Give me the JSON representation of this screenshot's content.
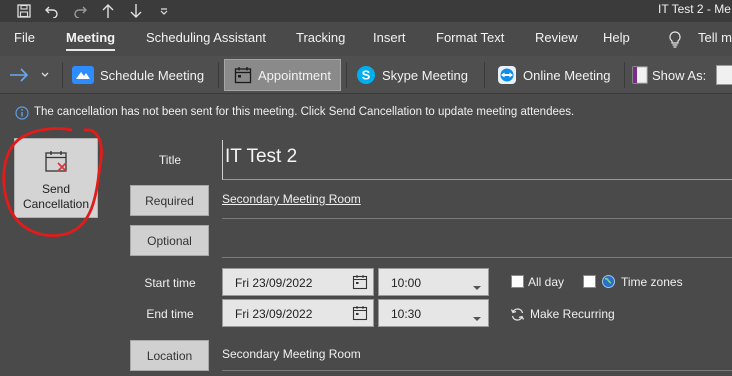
{
  "window": {
    "title": "IT Test 2  -  Me"
  },
  "quick_access": {
    "icons": [
      "save-icon",
      "undo-icon",
      "redo-icon",
      "up-arrow-icon",
      "down-arrow-icon",
      "customize-qat-icon"
    ]
  },
  "ribbon": {
    "tabs": [
      {
        "label": "File"
      },
      {
        "label": "Meeting",
        "active": true
      },
      {
        "label": "Scheduling Assistant"
      },
      {
        "label": "Tracking"
      },
      {
        "label": "Insert"
      },
      {
        "label": "Format Text"
      },
      {
        "label": "Review"
      },
      {
        "label": "Help"
      },
      {
        "label": "Tell m"
      }
    ],
    "toolbar": {
      "schedule_meeting": "Schedule Meeting",
      "appointment": "Appointment",
      "skype_meeting": "Skype Meeting",
      "online_meeting": "Online Meeting",
      "show_as": "Show As:"
    }
  },
  "info_bar": {
    "message": "The cancellation has not been sent for this meeting. Click Send Cancellation to update meeting attendees."
  },
  "send": {
    "line1": "Send",
    "line2": "Cancellation"
  },
  "form": {
    "title_label": "Title",
    "title_value": "IT Test 2",
    "required_label": "Required",
    "required_value": "Secondary Meeting Room",
    "optional_label": "Optional",
    "optional_value": "",
    "start_label": "Start time",
    "start_date": "Fri 23/09/2022",
    "start_time": "10:00",
    "all_day_label": "All day",
    "time_zones_label": "Time zones",
    "end_label": "End time",
    "end_date": "Fri 23/09/2022",
    "end_time": "10:30",
    "make_recurring_label": "Make Recurring",
    "location_label": "Location",
    "location_value": "Secondary Meeting Room"
  },
  "colors": {
    "background": "#4a4a4a",
    "annotation_circle": "#e21b1b",
    "skype_blue": "#00aff0"
  }
}
